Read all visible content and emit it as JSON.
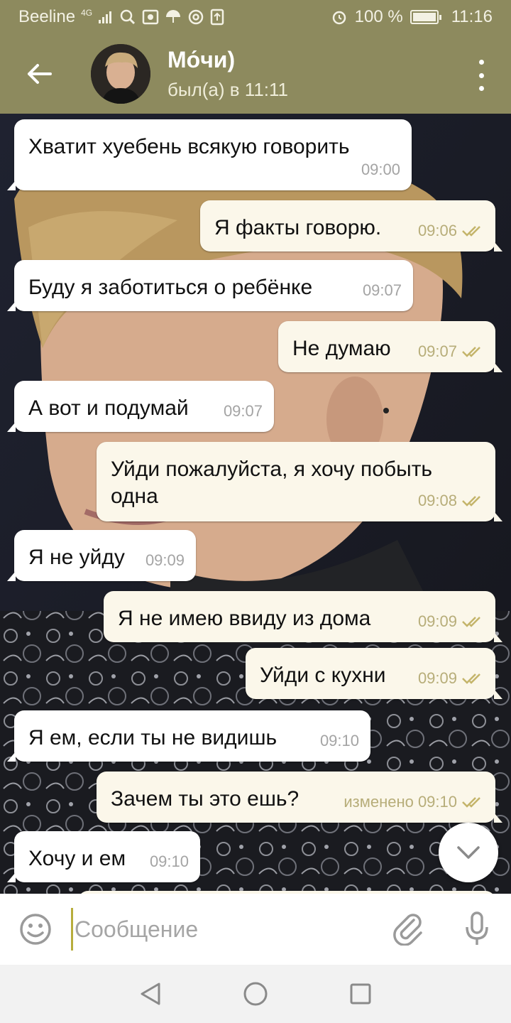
{
  "status_bar": {
    "carrier": "Beeline",
    "network": "4G",
    "battery": "100 %",
    "time": "11:16"
  },
  "header": {
    "name": "Мо́чи)",
    "status": "был(а) в 11:11"
  },
  "messages": [
    {
      "dir": "in",
      "text": "Хватит хуебень всякую говорить",
      "time": "09:00"
    },
    {
      "dir": "out",
      "text": "Я факты говорю.",
      "time": "09:06"
    },
    {
      "dir": "in",
      "text": "Буду я заботиться о ребёнке",
      "time": "09:07"
    },
    {
      "dir": "out",
      "text": "Не думаю",
      "time": "09:07"
    },
    {
      "dir": "in",
      "text": "А вот и подумай",
      "time": "09:07"
    },
    {
      "dir": "out",
      "text": "Уйди пожалуйста, я хочу побыть одна",
      "time": "09:08"
    },
    {
      "dir": "in",
      "text": "Я не уйду",
      "time": "09:09"
    },
    {
      "dir": "out",
      "text": "Я не имею ввиду из дома",
      "time": "09:09"
    },
    {
      "dir": "out",
      "text": "Уйди с кухни",
      "time": "09:09"
    },
    {
      "dir": "in",
      "text": "Я ем, если ты не видишь",
      "time": "09:10"
    },
    {
      "dir": "out",
      "text": "Зачем ты это ешь?",
      "time": "изменено 09:10"
    },
    {
      "dir": "in",
      "text": "Хочу и ем",
      "time": "09:10"
    }
  ],
  "input": {
    "placeholder": "Сообщение"
  },
  "colors": {
    "header": "#8d8a5e",
    "outgoing_bubble": "#fbf7ea",
    "incoming_bubble": "#ffffff",
    "read_ticks": "#b7ad79"
  },
  "icons": {
    "back": "arrow-left-icon",
    "menu": "more-vertical-icon",
    "emoji": "smile-icon",
    "attach": "paperclip-icon",
    "mic": "microphone-icon",
    "scroll": "chevron-down-icon"
  }
}
